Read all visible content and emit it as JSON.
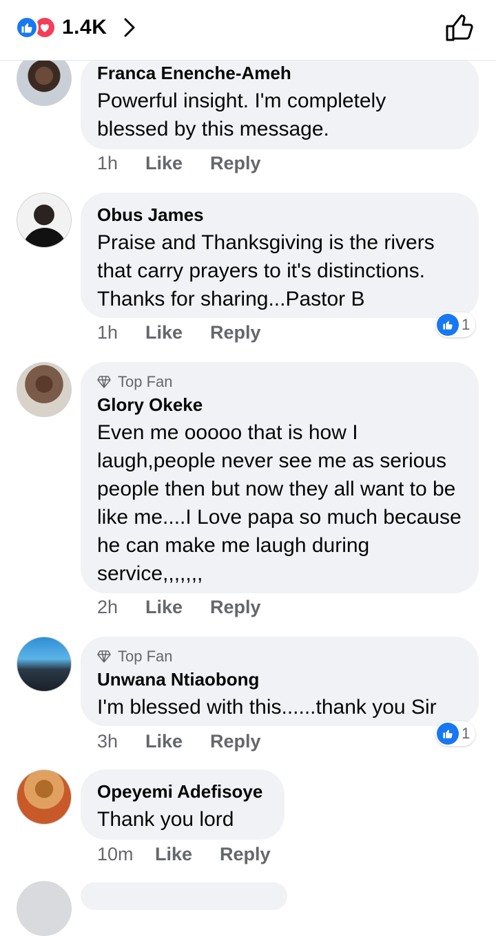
{
  "header": {
    "reaction_count": "1.4K",
    "reaction_icons": [
      "like-icon",
      "love-icon"
    ],
    "like_icon": "thumbs-up-outline-icon",
    "colors": {
      "like": "#1877f2",
      "love": "#f33e58"
    }
  },
  "comments": [
    {
      "author": "Franca Enenche-Ameh",
      "text": "Powerful insight. I'm completely blessed by this message.",
      "time": "1h",
      "like_label": "Like",
      "reply_label": "Reply"
    },
    {
      "author": "Obus James",
      "text": "Praise and Thanksgiving is the rivers that carry prayers to it's distinctions. Thanks for sharing...Pastor B",
      "time": "1h",
      "like_label": "Like",
      "reply_label": "Reply",
      "reaction_count": "1"
    },
    {
      "badge": "Top Fan",
      "author": "Glory Okeke",
      "text": "Even me ooooo that is how I laugh,people never see me as serious people then but now they all want to be like me....I Love papa so much because he can make me laugh during service,,,,,,,",
      "time": "2h",
      "like_label": "Like",
      "reply_label": "Reply"
    },
    {
      "badge": "Top Fan",
      "author": "Unwana Ntiaobong",
      "text": "I'm blessed with this......thank you Sir",
      "time": "3h",
      "like_label": "Like",
      "reply_label": "Reply",
      "reaction_count": "1"
    },
    {
      "author": "Opeyemi Adefisoye",
      "text": "Thank you lord",
      "time": "10m",
      "like_label": "Like",
      "reply_label": "Reply"
    }
  ]
}
